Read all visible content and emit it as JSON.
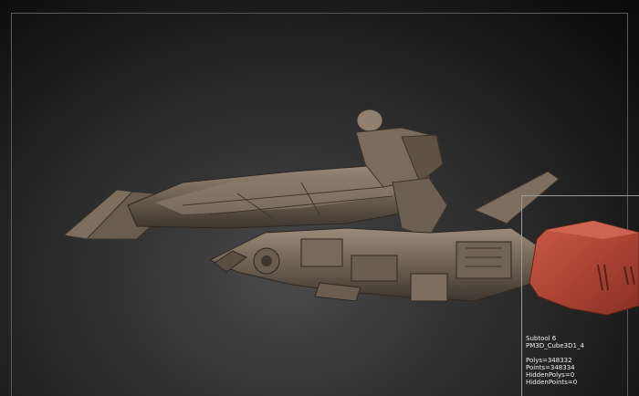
{
  "colors": {
    "model_base": "#6b5d50",
    "model_light": "#8f806f",
    "model_dark": "#3a322b",
    "selected_subtool": "#b24a3b",
    "frame": "#5a5a5a",
    "info_text": "#f2f2f2"
  },
  "info": {
    "subtool": "Subtool 6",
    "name": "PM3D_Cube3D1_4",
    "polys": "Polys=348332",
    "points": "Points=348334",
    "hidden_polys": "HiddenPolys=0",
    "hidden_points": "HiddenPoints=0"
  }
}
